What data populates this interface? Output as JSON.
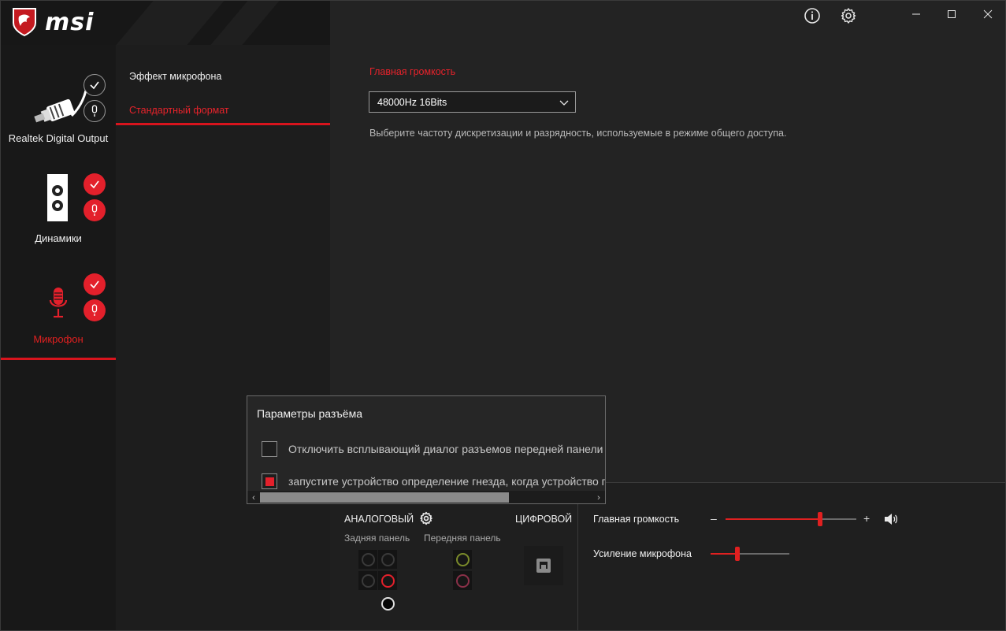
{
  "brand": {
    "logo_text": "msi"
  },
  "titlebar": {
    "info_icon": "info-icon",
    "settings_icon": "gear-icon",
    "minimize": "—",
    "maximize": "☐",
    "close": "✕"
  },
  "devices": [
    {
      "label": "Realtek Digital Output",
      "active": false,
      "check_badge": "grey",
      "mic_badge": "grey"
    },
    {
      "label": "Динамики",
      "active": false,
      "check_badge": "red",
      "mic_badge": "red"
    },
    {
      "label": "Микрофон",
      "active": true,
      "check_badge": "red",
      "mic_badge": "red"
    }
  ],
  "menu": {
    "items": [
      {
        "label": "Эффект микрофона",
        "active": false
      },
      {
        "label": "Стандартный формат",
        "active": true
      }
    ]
  },
  "main": {
    "section_title": "Главная громкость",
    "format_select": "48000Hz 16Bits",
    "description": "Выберите частоту дискретизации и разрядность, используемые в режиме общего доступа."
  },
  "bottom": {
    "analog_label": "АНАЛОГОВЫЙ",
    "digital_label": "ЦИФРОВОЙ",
    "rear_panel": "Задняя панель",
    "front_panel": "Передняя панель",
    "jack_colors": {
      "rear_inactive": "#3a3a3a",
      "rear_active_mic": "#e3202b",
      "rear_black": "#101010",
      "front_green": "#7a8a2a",
      "front_pink": "#8a3048"
    },
    "master_volume_label": "Главная громкость",
    "master_volume_minus": "–",
    "master_volume_plus": "+",
    "master_volume_level": 0.72,
    "mic_boost_label": "Усиление микрофона",
    "mic_boost_level": 0.34
  },
  "dialog": {
    "title": "Параметры разъёма",
    "option1": "Отключить всплывающий диалог разъемов передней панели",
    "option1_checked": false,
    "option2": "запустите устройство определение гнезда, когда  устройство подключено",
    "option2_checked": true,
    "scroll_left": "‹",
    "scroll_right": "›"
  },
  "colors": {
    "accent": "#e3202b",
    "bg": "#232323",
    "sidebar": "#181818"
  }
}
